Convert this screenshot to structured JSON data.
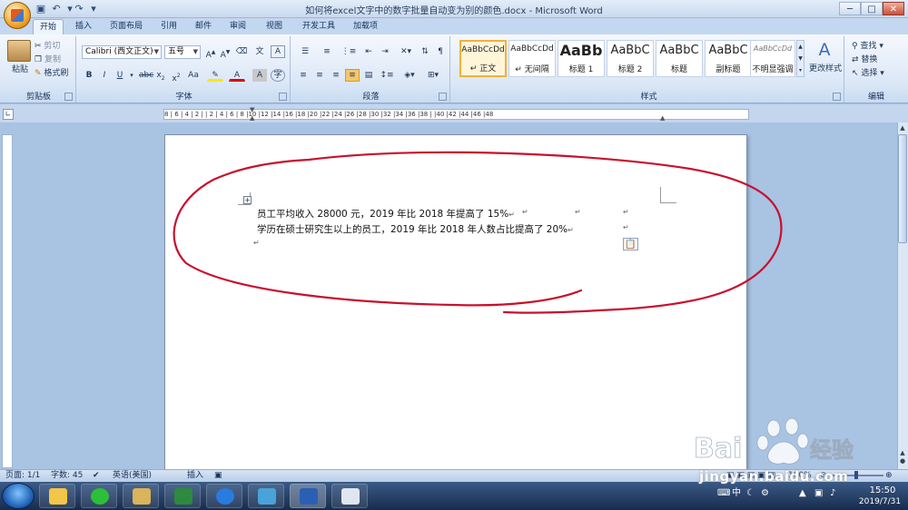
{
  "window": {
    "title": "如何将excel文字中的数字批量自动变为别的颜色.docx - Microsoft Word",
    "qat": {
      "save_icon": "save-icon",
      "undo_icon": "undo-icon",
      "redo_icon": "redo-icon"
    },
    "controls": {
      "minimize": "─",
      "maximize": "□",
      "close": "✕"
    }
  },
  "tabs": [
    {
      "label": "开始",
      "active": true
    },
    {
      "label": "插入"
    },
    {
      "label": "页面布局"
    },
    {
      "label": "引用"
    },
    {
      "label": "邮件"
    },
    {
      "label": "审阅"
    },
    {
      "label": "视图"
    },
    {
      "label": "开发工具"
    },
    {
      "label": "加载项"
    }
  ],
  "ribbon": {
    "clipboard": {
      "label": "剪贴板",
      "paste": "粘贴",
      "cut": "剪切",
      "copy": "复制",
      "format_painter": "格式刷"
    },
    "font": {
      "label": "字体",
      "font_name": "Calibri (西文正文)",
      "font_size": "五号"
    },
    "paragraph": {
      "label": "段落"
    },
    "styles": {
      "label": "样式",
      "items": [
        {
          "sample": "AaBbCcDd",
          "name": "↵ 正文",
          "selected": true
        },
        {
          "sample": "AaBbCcDd",
          "name": "↵ 无间隔"
        },
        {
          "sample": "AaBb",
          "name": "标题 1"
        },
        {
          "sample": "AaBbC",
          "name": "标题 2"
        },
        {
          "sample": "AaBbC",
          "name": "标题"
        },
        {
          "sample": "AaBbC",
          "name": "副标题"
        },
        {
          "sample": "AaBbCcDd",
          "name": "不明显强调"
        }
      ],
      "change_styles": "更改样式"
    },
    "editing": {
      "label": "编辑",
      "find": "查找",
      "replace": "替换",
      "select": "选择"
    }
  },
  "ruler": {
    "marks": "8 | 6 | 4 | 2 | | 2 | 4 | 6 | 8 |10 |12 |14 |16 |18 |20 |22 |24 |26 |28 |30 |32 |34 |36 |38 | |40 |42 |44 |46 |48"
  },
  "document": {
    "lines": [
      {
        "text": "员工平均收入 28000 元，2019 年比 2018 年提高了 15%"
      },
      {
        "text": "学历在硕士研究生以上的员工，2019 年比 2018 年人数占比提高了 20%"
      }
    ],
    "para_mark": "↵"
  },
  "status": {
    "page": "页面: 1/1",
    "words": "字数: 45",
    "language": "英语(美国)",
    "insert": "插入",
    "zoom": "100%"
  },
  "taskbar": {
    "tray_text": "中",
    "time": "15:50",
    "date": "2019/7/31"
  },
  "watermark": {
    "text": "jingyan.baidu.com"
  },
  "colors": {
    "annotation": "#c8102e",
    "ribbon_bg": "#dce8f7",
    "workspace": "#a9c3e3"
  }
}
